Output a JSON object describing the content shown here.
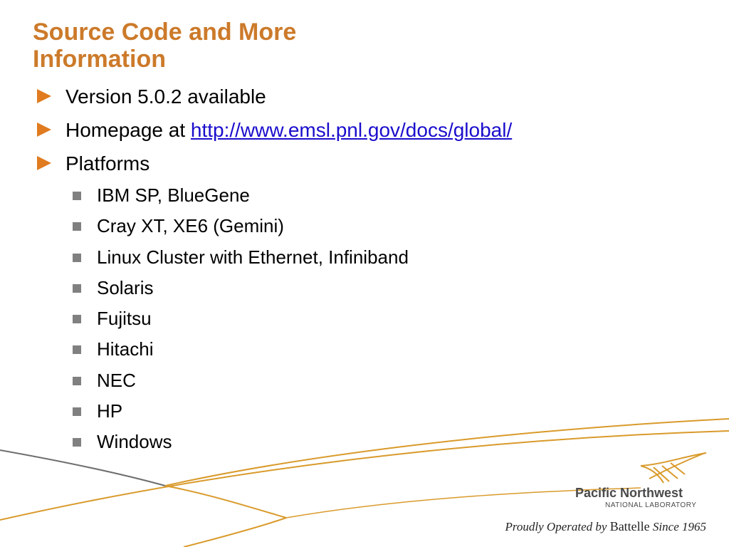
{
  "title": {
    "line1": "Source Code and More",
    "line2": "Information"
  },
  "bullets": [
    {
      "text": "Version 5.0.2 available"
    },
    {
      "prefix": "Homepage at ",
      "link": "http://www.emsl.pnl.gov/docs/global/"
    },
    {
      "text": "Platforms"
    }
  ],
  "platforms": [
    "IBM SP, BlueGene",
    "Cray XT, XE6 (Gemini)",
    "Linux Cluster with Ethernet, Infiniband",
    "Solaris",
    "Fujitsu",
    "Hitachi",
    "NEC",
    "HP",
    "Windows"
  ],
  "footer": {
    "logo_name": "Pacific Northwest",
    "logo_sub": "NATIONAL LABORATORY",
    "tagline_italic": "Proudly Operated by",
    "tagline_brand": "Battelle",
    "tagline_since": "Since 1965"
  },
  "colors": {
    "title": "#cc7a2a",
    "arrow": "#e07b1f",
    "link": "#1a0dcc",
    "square_bullet": "#808080",
    "swoosh_gold": "#d99a2b",
    "swoosh_gray": "#6e6e6e"
  }
}
